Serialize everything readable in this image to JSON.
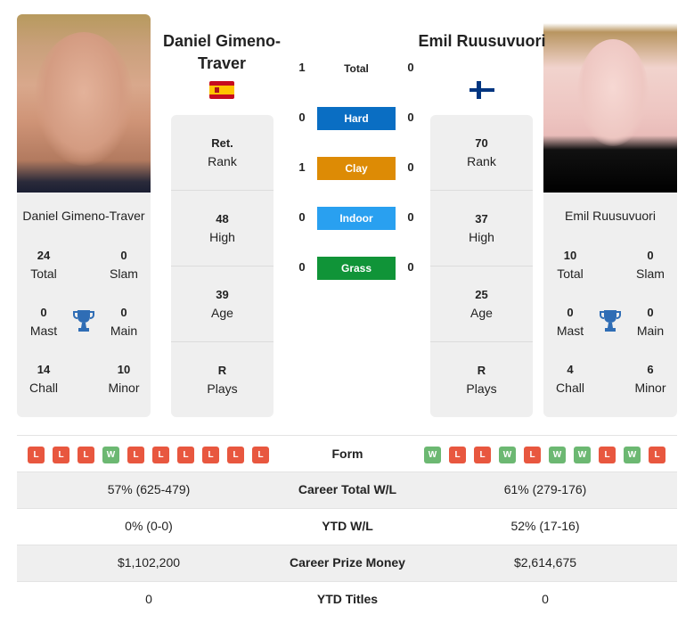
{
  "player_left": {
    "name_header": "Daniel Gimeno-Traver",
    "name_card": "Daniel Gimeno-Traver",
    "country_flag": "spain-flag",
    "rank_value": "Ret.",
    "rank_label": "Rank",
    "high_value": "48",
    "high_label": "High",
    "age_value": "39",
    "age_label": "Age",
    "plays_value": "R",
    "plays_label": "Plays",
    "titles": {
      "total_value": "24",
      "total_label": "Total",
      "slam_value": "0",
      "slam_label": "Slam",
      "mast_value": "0",
      "mast_label": "Mast",
      "main_value": "0",
      "main_label": "Main",
      "chall_value": "14",
      "chall_label": "Chall",
      "minor_value": "10",
      "minor_label": "Minor"
    },
    "form": [
      "L",
      "L",
      "L",
      "W",
      "L",
      "L",
      "L",
      "L",
      "L",
      "L"
    ]
  },
  "player_right": {
    "name_header": "Emil Ruusuvuori",
    "name_card": "Emil Ruusuvuori",
    "country_flag": "finland-flag",
    "rank_value": "70",
    "rank_label": "Rank",
    "high_value": "37",
    "high_label": "High",
    "age_value": "25",
    "age_label": "Age",
    "plays_value": "R",
    "plays_label": "Plays",
    "titles": {
      "total_value": "10",
      "total_label": "Total",
      "slam_value": "0",
      "slam_label": "Slam",
      "mast_value": "0",
      "mast_label": "Mast",
      "main_value": "0",
      "main_label": "Main",
      "chall_value": "4",
      "chall_label": "Chall",
      "minor_value": "6",
      "minor_label": "Minor"
    },
    "form": [
      "W",
      "L",
      "L",
      "W",
      "L",
      "W",
      "W",
      "L",
      "W",
      "L"
    ]
  },
  "head_to_head": [
    {
      "label": "Total",
      "left": "1",
      "right": "0",
      "color": ""
    },
    {
      "label": "Hard",
      "left": "0",
      "right": "0",
      "color": "#0a6ec3"
    },
    {
      "label": "Clay",
      "left": "1",
      "right": "0",
      "color": "#dd8b05"
    },
    {
      "label": "Indoor",
      "left": "0",
      "right": "0",
      "color": "#29a0f0"
    },
    {
      "label": "Grass",
      "left": "0",
      "right": "0",
      "color": "#109438"
    }
  ],
  "form_label": "Form",
  "stats": [
    {
      "label": "Career Total W/L",
      "left": "57% (625-479)",
      "right": "61% (279-176)"
    },
    {
      "label": "YTD W/L",
      "left": "0% (0-0)",
      "right": "52% (17-16)"
    },
    {
      "label": "Career Prize Money",
      "left": "$1,102,200",
      "right": "$2,614,675"
    },
    {
      "label": "YTD Titles",
      "left": "0",
      "right": "0"
    }
  ],
  "colors": {
    "loss": "#e8573f",
    "win": "#6cb872",
    "trophy": "#2f6db5",
    "card_bg": "#efefef"
  }
}
